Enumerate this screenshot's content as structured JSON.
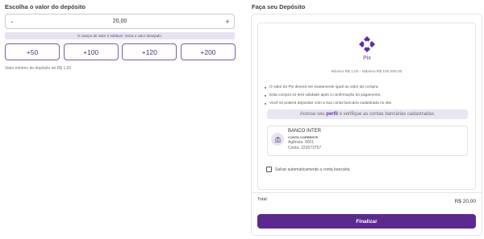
{
  "left": {
    "title": "Escolha o valor do depósito",
    "amount": {
      "decrement_label": "-",
      "value": "20,00",
      "increment_label": "+"
    },
    "hint": "O campo de valor é editável. Insira o valor desejado.",
    "quick_amounts": [
      "+50",
      "+100",
      "+120",
      "+200"
    ],
    "min_value_text": "Valor mínimo de depósito de R$ 1,00"
  },
  "right": {
    "title": "Faça seu Depósito",
    "method": {
      "name": "Pix",
      "icon": "pix-icon",
      "color": "#5e2ca5"
    },
    "limits": "Mínimo R$ 1,00 - Máximo R$ 100.000,00",
    "rules": [
      "O valor do Pix deverá ser exatamente igual ao valor da compra.",
      "Esta compra só terá validade após a confirmação do pagamento.",
      "Você só poderá depositar com a sua conta bancária cadastrada no site."
    ],
    "perfil_banner": {
      "prefix": "Acesse seu ",
      "link": "perfil",
      "suffix": " e verifique as contas bancárias cadastradas."
    },
    "bank": {
      "name": "BANCO INTER",
      "type": "CONTA CORRENTE",
      "agency": "Agência: 0001",
      "account": "Conta: 223673757"
    },
    "save_label": "Salvar automaticamente a conta bancária.",
    "total_label": "Total:",
    "total_value": "R$ 20,00",
    "finalize_label": "Finalizar"
  },
  "colors": {
    "accent": "#5c2a8f",
    "hint_bg": "#e7e3f1"
  }
}
